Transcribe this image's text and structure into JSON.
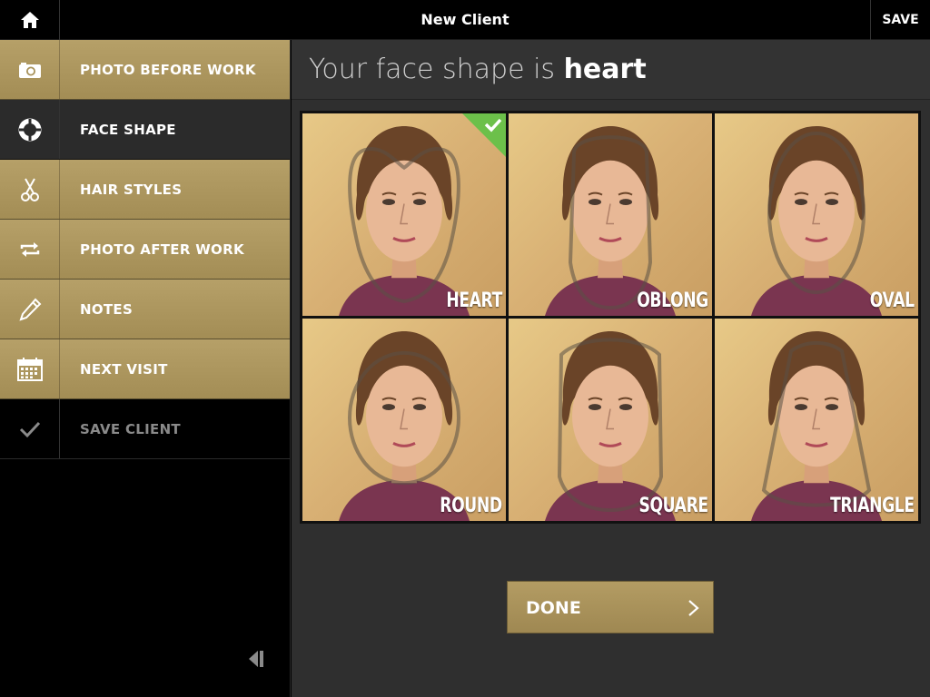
{
  "topbar": {
    "title": "New Client",
    "save_label": "SAVE",
    "home_icon": "home-icon"
  },
  "sidebar": {
    "items": [
      {
        "label": "PHOTO BEFORE WORK",
        "icon": "camera-icon",
        "state": "gold"
      },
      {
        "label": "FACE SHAPE",
        "icon": "crosshair-icon",
        "state": "active"
      },
      {
        "label": "HAIR STYLES",
        "icon": "scissors-icon",
        "state": "gold"
      },
      {
        "label": "PHOTO AFTER WORK",
        "icon": "repeat-icon",
        "state": "gold"
      },
      {
        "label": "NOTES",
        "icon": "pencil-icon",
        "state": "gold"
      },
      {
        "label": "NEXT VISIT",
        "icon": "calendar-icon",
        "state": "gold"
      },
      {
        "label": "SAVE CLIENT",
        "icon": "checkmark-icon",
        "state": "dark"
      }
    ],
    "collapse_icon": "collapse-sidebar-icon"
  },
  "main": {
    "heading_prefix": "Your face shape is ",
    "heading_value": "heart",
    "shapes": [
      {
        "label": "HEART",
        "selected": true
      },
      {
        "label": "OBLONG",
        "selected": false
      },
      {
        "label": "OVAL",
        "selected": false
      },
      {
        "label": "ROUND",
        "selected": false
      },
      {
        "label": "SQUARE",
        "selected": false
      },
      {
        "label": "TRIANGLE",
        "selected": false
      }
    ],
    "done_label": "DONE"
  },
  "colors": {
    "gold": "#b6a068",
    "selected_check": "#6cc04a",
    "panel": "#2f2f2f"
  }
}
